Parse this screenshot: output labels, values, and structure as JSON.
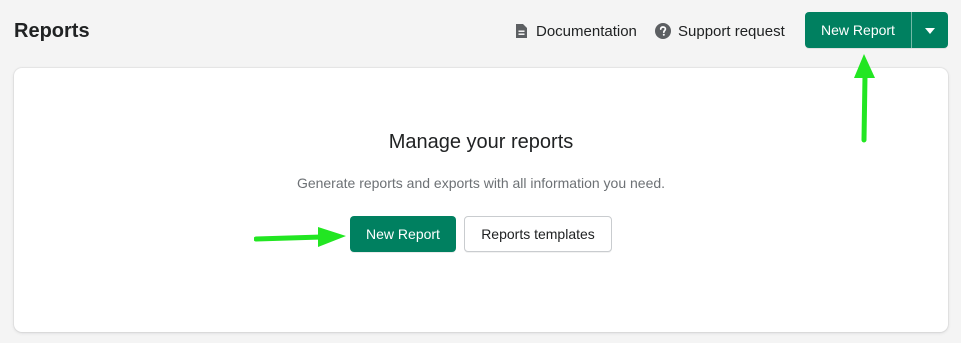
{
  "header": {
    "title": "Reports",
    "documentation_label": "Documentation",
    "documentation_icon": "document-icon",
    "support_label": "Support request",
    "support_icon": "question-circle-icon",
    "new_report_label": "New Report",
    "dropdown_icon": "caret-down-icon"
  },
  "card": {
    "heading": "Manage your reports",
    "subtext": "Generate reports and exports with all information you need.",
    "new_report_label": "New Report",
    "templates_label": "Reports templates"
  },
  "annotations": {
    "arrow_color": "#22e622"
  },
  "colors": {
    "primary": "#008060",
    "background": "#f4f4f4",
    "card": "#ffffff"
  }
}
